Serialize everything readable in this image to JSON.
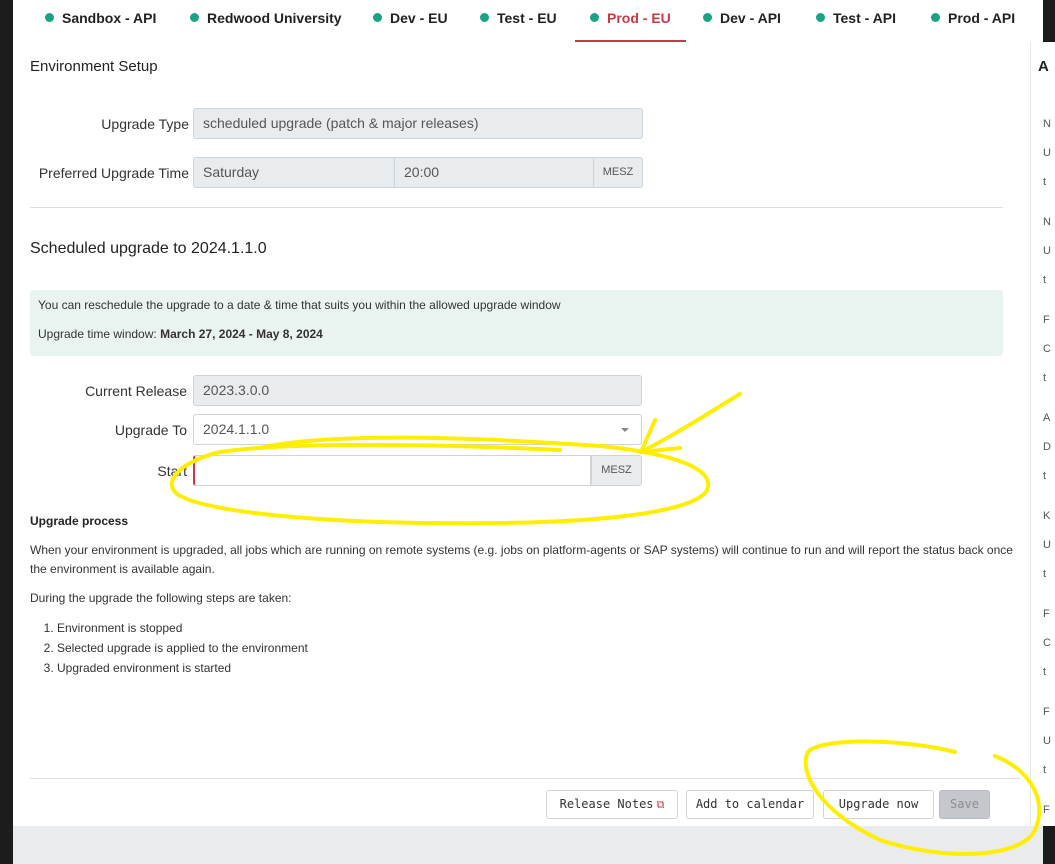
{
  "tabs": [
    {
      "label": "Sandbox - API",
      "status_color": "#1aa380",
      "active": false
    },
    {
      "label": "Redwood University",
      "status_color": "#1aa380",
      "active": false
    },
    {
      "label": "Dev - EU",
      "status_color": "#1aa380",
      "active": false
    },
    {
      "label": "Test - EU",
      "status_color": "#1aa380",
      "active": false
    },
    {
      "label": "Prod - EU",
      "status_color": "#1aa380",
      "active": true
    },
    {
      "label": "Dev - API",
      "status_color": "#1aa380",
      "active": false
    },
    {
      "label": "Test - API",
      "status_color": "#1aa380",
      "active": false
    },
    {
      "label": "Prod - API",
      "status_color": "#1aa380",
      "active": false
    }
  ],
  "environment_setup": {
    "title": "Environment Setup",
    "upgrade_type_label": "Upgrade Type",
    "upgrade_type_value": "scheduled upgrade (patch & major releases)",
    "preferred_time_label": "Preferred Upgrade Time",
    "preferred_day": "Saturday",
    "preferred_time": "20:00",
    "timezone": "MESZ"
  },
  "scheduled": {
    "title": "Scheduled upgrade to 2024.1.1.0",
    "info_line1": "You can reschedule the upgrade to a date & time that suits you within the allowed upgrade window",
    "window_label": "Upgrade time window:",
    "window_value": "March 27, 2024 - May 8, 2024",
    "current_release_label": "Current Release",
    "current_release_value": "2023.3.0.0",
    "upgrade_to_label": "Upgrade To",
    "upgrade_to_value": "2024.1.1.0",
    "start_label": "Start",
    "start_value": "",
    "start_timezone": "MESZ"
  },
  "process": {
    "title": "Upgrade process",
    "para1": "When your environment is upgraded, all jobs which are running on remote systems (e.g. jobs on platform-agents or SAP systems) will continue to run and will report the status back once the environment is available again.",
    "para2": "During the upgrade the following steps are taken:",
    "steps": [
      "Environment is stopped",
      "Selected upgrade is applied to the environment",
      "Upgraded environment is started"
    ]
  },
  "buttons": {
    "release_notes": "Release Notes",
    "add_calendar": "Add to calendar",
    "upgrade_now": "Upgrade now",
    "save": "Save"
  },
  "right_column": {
    "heading": "A",
    "chars": [
      "N",
      "U",
      "t",
      "N",
      "U",
      "t",
      "F",
      "C",
      "t",
      "A",
      "D",
      "t",
      "K",
      "U",
      "t",
      "F",
      "C",
      "t",
      "F",
      "U",
      "t",
      "F"
    ]
  },
  "annotation_color": "#ffee00",
  "accent_color": "#c93844"
}
